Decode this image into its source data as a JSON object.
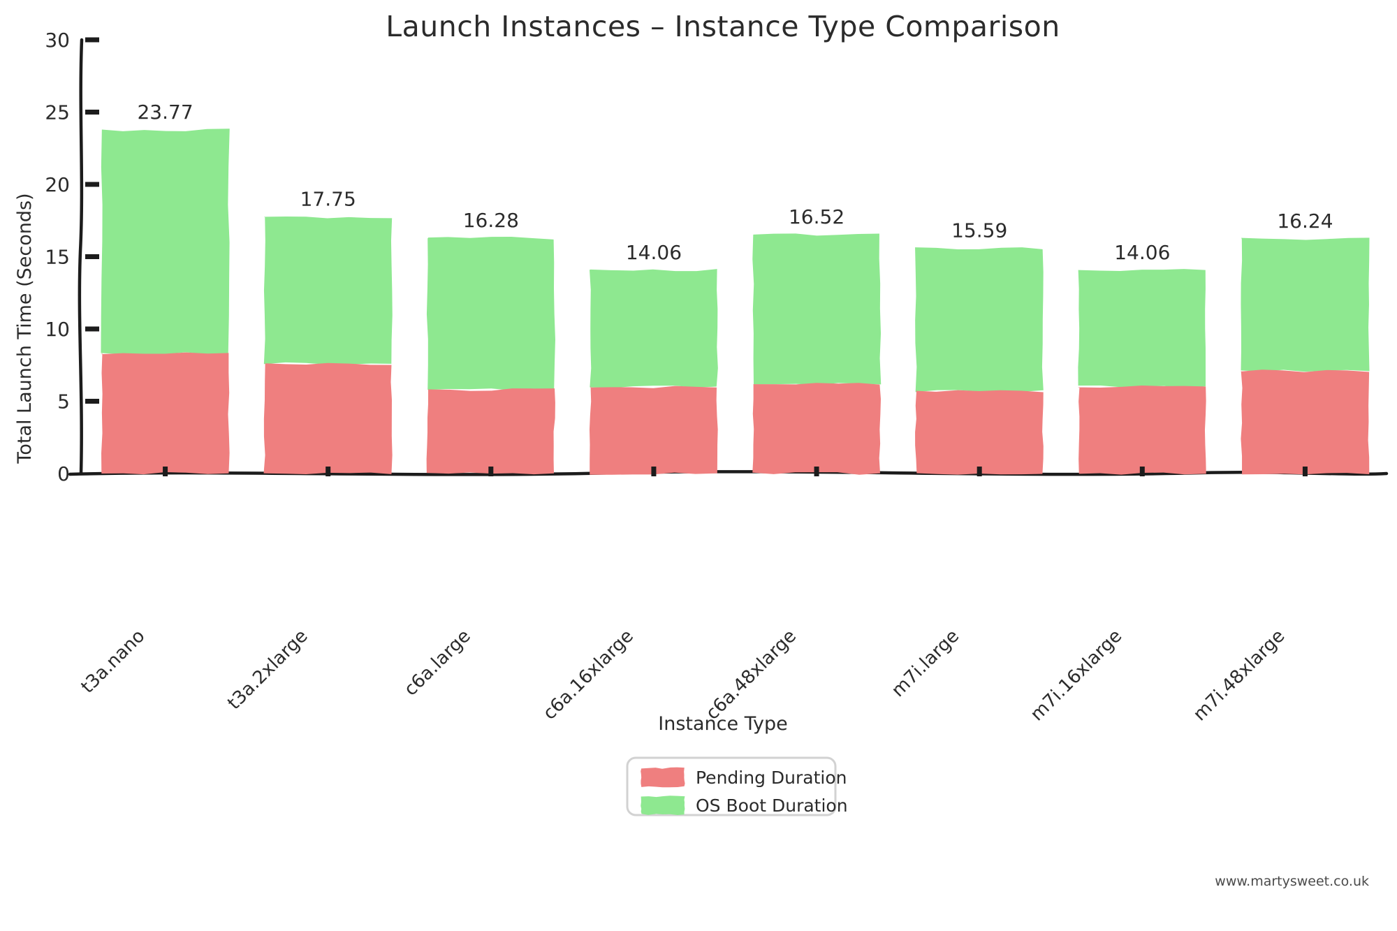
{
  "chart_data": {
    "type": "bar",
    "subtype": "stacked-bar",
    "title": "Launch Instances – Instance Type Comparison",
    "xlabel": "Instance Type",
    "ylabel": "Total Launch Time (Seconds)",
    "categories": [
      "t3a.nano",
      "t3a.2xlarge",
      "c6a.large",
      "c6a.16xlarge",
      "c6a.48xlarge",
      "m7i.large",
      "m7i.16xlarge",
      "m7i.48xlarge"
    ],
    "series": [
      {
        "name": "Pending Duration",
        "color": "#ef7f7f",
        "values": [
          8.3,
          7.6,
          5.8,
          6.0,
          6.2,
          5.7,
          6.0,
          7.1
        ]
      },
      {
        "name": "OS Boot Duration",
        "color": "#8ee890",
        "values": [
          15.47,
          10.15,
          10.48,
          8.06,
          10.32,
          9.89,
          8.06,
          9.14
        ]
      }
    ],
    "totals": [
      23.77,
      17.75,
      16.28,
      14.06,
      16.52,
      15.59,
      14.06,
      16.24
    ],
    "total_labels": [
      "23.77",
      "17.75",
      "16.28",
      "14.06",
      "16.52",
      "15.59",
      "14.06",
      "16.24"
    ],
    "ylim": [
      0,
      30
    ],
    "yticks": [
      0,
      5,
      10,
      15,
      20,
      25,
      30
    ],
    "ytick_labels": [
      "0",
      "5",
      "10",
      "15",
      "20",
      "25",
      "30"
    ],
    "grid": false,
    "legend_position": "bottom-center",
    "style": "xkcd-handdrawn",
    "xtick_rotation_degrees": -45
  },
  "watermark": {
    "text": "www.martysweet.co.uk"
  }
}
